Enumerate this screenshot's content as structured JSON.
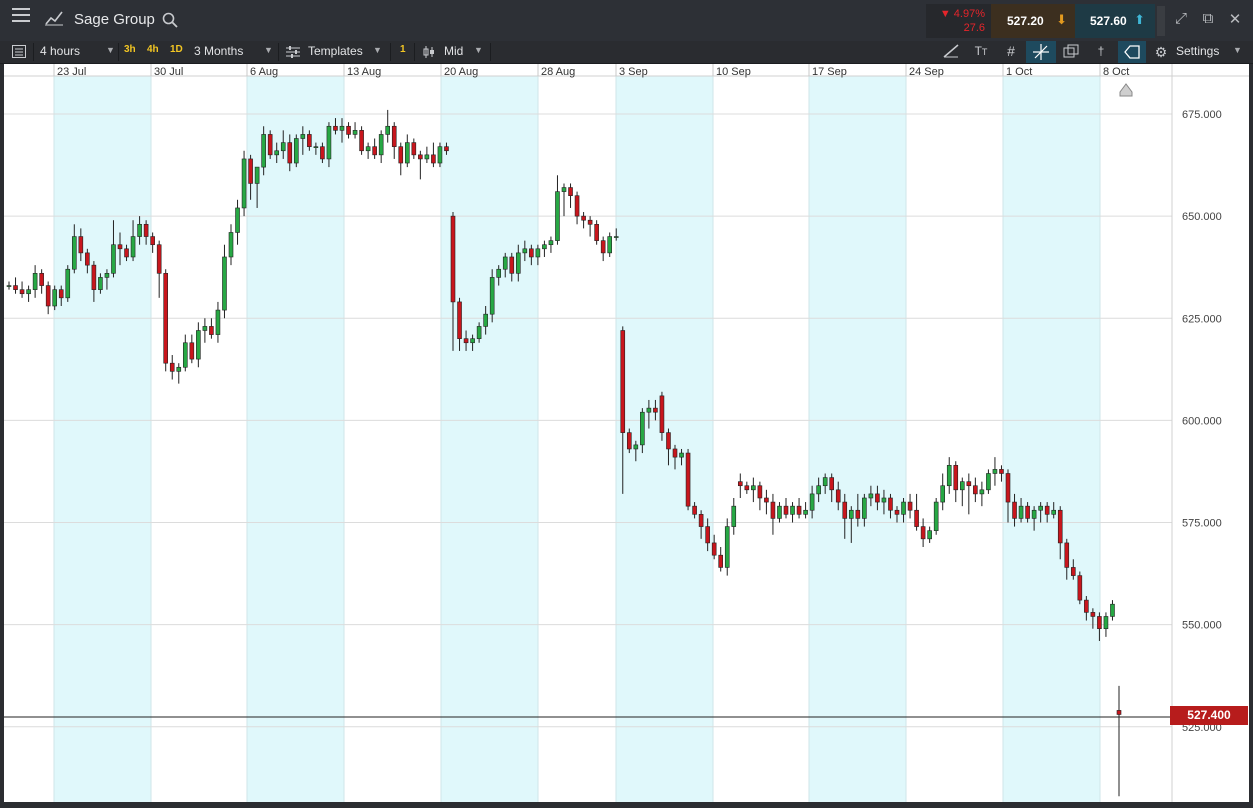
{
  "header": {
    "title": "Sage Group",
    "change_pct": "▼ 4.97%",
    "change_abs": "27.6",
    "sell_price": "527.20",
    "buy_price": "527.60"
  },
  "toolbar": {
    "interval": "4 hours",
    "quick_3h": "3h",
    "quick_4h": "4h",
    "quick_1d": "1D",
    "range": "3 Months",
    "templates": "Templates",
    "count": "1",
    "price_type": "Mid",
    "settings": "Settings"
  },
  "icons": [
    "menu-icon",
    "line-chart-icon",
    "search-icon",
    "arrow-down-icon",
    "arrow-up-icon",
    "expand-icon",
    "popout-icon",
    "close-icon",
    "list-icon",
    "templates-icon",
    "candles-icon",
    "draw-icon",
    "text-icon",
    "grid-icon",
    "crosshair-icon",
    "layers-icon",
    "marker-icon",
    "tag-icon",
    "gear-icon"
  ],
  "colors": {
    "up": "#27a844",
    "down": "#c8161d",
    "shade": "#e0f8fb",
    "current": "#b71c1c",
    "accent": "#1e4a5e"
  },
  "chart_data": {
    "type": "candlestick",
    "title": "",
    "xlabel": "",
    "ylabel": "",
    "x_tick_labels": [
      "23 Jul",
      "30 Jul",
      "6 Aug",
      "13 Aug",
      "20 Aug",
      "28 Aug",
      "3 Sep",
      "10 Sep",
      "17 Sep",
      "24 Sep",
      "1 Oct",
      "8 Oct"
    ],
    "y_tick_labels": [
      "675.000",
      "650.000",
      "625.000",
      "600.000",
      "575.000",
      "550.000",
      "525.000"
    ],
    "y_ticks": [
      675,
      650,
      625,
      600,
      575,
      550,
      525
    ],
    "ylim": [
      507,
      682
    ],
    "current_price": 527.4,
    "current_price_label": "527.400",
    "grid": true,
    "candle_period": "4 hours",
    "ohlc": [
      [
        633,
        634,
        632,
        633
      ],
      [
        633,
        635,
        631,
        632
      ],
      [
        632,
        634,
        630,
        631
      ],
      [
        631,
        633,
        629,
        632
      ],
      [
        632,
        638,
        630,
        636
      ],
      [
        636,
        637,
        631,
        633
      ],
      [
        633,
        634,
        626,
        628
      ],
      [
        628,
        633,
        627,
        632
      ],
      [
        632,
        633,
        628,
        630
      ],
      [
        630,
        638,
        629,
        637
      ],
      [
        637,
        648,
        636,
        645
      ],
      [
        645,
        647,
        639,
        641
      ],
      [
        641,
        642,
        636,
        638
      ],
      [
        638,
        639,
        629,
        632
      ],
      [
        632,
        636,
        631,
        635
      ],
      [
        635,
        637,
        632,
        636
      ],
      [
        636,
        649,
        635,
        643
      ],
      [
        643,
        646,
        638,
        642
      ],
      [
        642,
        643,
        639,
        640
      ],
      [
        640,
        649,
        639,
        645
      ],
      [
        645,
        650,
        643,
        648
      ],
      [
        648,
        649,
        643,
        645
      ],
      [
        645,
        646,
        641,
        643
      ],
      [
        643,
        644,
        630,
        636
      ],
      [
        636,
        637,
        612,
        614
      ],
      [
        614,
        616,
        610,
        612
      ],
      [
        612,
        614,
        609,
        613
      ],
      [
        613,
        621,
        612,
        619
      ],
      [
        619,
        621,
        614,
        615
      ],
      [
        615,
        624,
        613,
        622
      ],
      [
        622,
        625,
        619,
        623
      ],
      [
        623,
        625,
        620,
        621
      ],
      [
        621,
        629,
        619,
        627
      ],
      [
        627,
        643,
        625,
        640
      ],
      [
        640,
        648,
        638,
        646
      ],
      [
        646,
        654,
        643,
        652
      ],
      [
        652,
        666,
        650,
        664
      ],
      [
        664,
        665,
        654,
        658
      ],
      [
        658,
        662,
        652,
        662
      ],
      [
        662,
        672,
        660,
        670
      ],
      [
        670,
        671,
        664,
        665
      ],
      [
        665,
        668,
        663,
        666
      ],
      [
        666,
        671,
        664,
        668
      ],
      [
        668,
        670,
        661,
        663
      ],
      [
        663,
        670,
        662,
        669
      ],
      [
        669,
        672,
        665,
        670
      ],
      [
        670,
        671,
        666,
        667
      ],
      [
        667,
        668,
        665,
        667
      ],
      [
        667,
        668,
        663,
        664
      ],
      [
        664,
        673,
        662,
        672
      ],
      [
        672,
        674,
        670,
        671
      ],
      [
        671,
        674,
        668,
        672
      ],
      [
        672,
        673,
        669,
        670
      ],
      [
        670,
        673,
        669,
        671
      ],
      [
        671,
        672,
        665,
        666
      ],
      [
        666,
        668,
        664,
        667
      ],
      [
        667,
        669,
        664,
        665
      ],
      [
        665,
        671,
        663,
        670
      ],
      [
        670,
        676,
        668,
        672
      ],
      [
        672,
        673,
        664,
        667
      ],
      [
        667,
        668,
        660,
        663
      ],
      [
        663,
        670,
        662,
        668
      ],
      [
        668,
        669,
        664,
        665
      ],
      [
        665,
        666,
        659,
        664
      ],
      [
        664,
        667,
        663,
        665
      ],
      [
        665,
        668,
        662,
        663
      ],
      [
        663,
        668,
        662,
        667
      ],
      [
        667,
        668,
        665,
        666
      ],
      [
        650,
        651,
        617,
        629
      ],
      [
        629,
        630,
        617,
        620
      ],
      [
        620,
        622,
        617,
        619
      ],
      [
        619,
        621,
        617,
        620
      ],
      [
        620,
        624,
        619,
        623
      ],
      [
        623,
        628,
        621,
        626
      ],
      [
        626,
        637,
        624,
        635
      ],
      [
        635,
        638,
        633,
        637
      ],
      [
        637,
        641,
        635,
        640
      ],
      [
        640,
        641,
        634,
        636
      ],
      [
        636,
        643,
        634,
        641
      ],
      [
        641,
        644,
        639,
        642
      ],
      [
        642,
        643,
        638,
        640
      ],
      [
        640,
        643,
        638,
        642
      ],
      [
        642,
        644,
        640,
        643
      ],
      [
        643,
        645,
        641,
        644
      ],
      [
        644,
        660,
        643,
        656
      ],
      [
        656,
        658,
        650,
        657
      ],
      [
        657,
        658,
        652,
        655
      ],
      [
        655,
        656,
        648,
        650
      ],
      [
        650,
        651,
        647,
        649
      ],
      [
        649,
        650,
        645,
        648
      ],
      [
        648,
        649,
        643,
        644
      ],
      [
        644,
        645,
        639,
        641
      ],
      [
        641,
        646,
        640,
        645
      ],
      [
        645,
        647,
        644,
        645
      ],
      [
        622,
        623,
        582,
        597
      ],
      [
        597,
        598,
        592,
        593
      ],
      [
        593,
        595,
        590,
        594
      ],
      [
        594,
        603,
        592,
        602
      ],
      [
        602,
        605,
        598,
        603
      ],
      [
        603,
        605,
        600,
        602
      ],
      [
        606,
        607,
        595,
        597
      ],
      [
        597,
        598,
        589,
        593
      ],
      [
        593,
        594,
        588,
        591
      ],
      [
        591,
        593,
        589,
        592
      ],
      [
        592,
        593,
        578,
        579
      ],
      [
        579,
        580,
        576,
        577
      ],
      [
        577,
        578,
        571,
        574
      ],
      [
        574,
        576,
        568,
        570
      ],
      [
        570,
        572,
        566,
        567
      ],
      [
        567,
        569,
        563,
        564
      ],
      [
        564,
        576,
        562,
        574
      ],
      [
        574,
        581,
        572,
        579
      ],
      [
        585,
        587,
        581,
        584
      ],
      [
        584,
        585,
        582,
        583
      ],
      [
        583,
        586,
        580,
        584
      ],
      [
        584,
        585,
        578,
        581
      ],
      [
        581,
        583,
        577,
        580
      ],
      [
        580,
        582,
        572,
        576
      ],
      [
        576,
        580,
        575,
        579
      ],
      [
        579,
        581,
        576,
        577
      ],
      [
        577,
        580,
        575,
        579
      ],
      [
        579,
        581,
        576,
        577
      ],
      [
        577,
        580,
        576,
        578
      ],
      [
        578,
        584,
        576,
        582
      ],
      [
        582,
        586,
        580,
        584
      ],
      [
        584,
        587,
        582,
        586
      ],
      [
        586,
        587,
        580,
        583
      ],
      [
        583,
        585,
        578,
        580
      ],
      [
        580,
        582,
        571,
        576
      ],
      [
        576,
        579,
        570,
        578
      ],
      [
        578,
        582,
        574,
        576
      ],
      [
        576,
        582,
        574,
        581
      ],
      [
        581,
        584,
        579,
        582
      ],
      [
        582,
        584,
        578,
        580
      ],
      [
        580,
        583,
        577,
        581
      ],
      [
        581,
        582,
        576,
        578
      ],
      [
        578,
        579,
        575,
        577
      ],
      [
        577,
        581,
        575,
        580
      ],
      [
        580,
        582,
        576,
        578
      ],
      [
        578,
        582,
        573,
        574
      ],
      [
        574,
        576,
        569,
        571
      ],
      [
        571,
        574,
        570,
        573
      ],
      [
        573,
        581,
        572,
        580
      ],
      [
        580,
        587,
        578,
        584
      ],
      [
        584,
        591,
        582,
        589
      ],
      [
        589,
        590,
        580,
        583
      ],
      [
        583,
        586,
        579,
        585
      ],
      [
        585,
        587,
        577,
        584
      ],
      [
        584,
        586,
        580,
        582
      ],
      [
        582,
        585,
        579,
        583
      ],
      [
        583,
        588,
        582,
        587
      ],
      [
        587,
        591,
        584,
        588
      ],
      [
        588,
        589,
        585,
        587
      ],
      [
        587,
        588,
        575,
        580
      ],
      [
        580,
        582,
        574,
        576
      ],
      [
        576,
        581,
        575,
        579
      ],
      [
        579,
        580,
        575,
        576
      ],
      [
        576,
        579,
        573,
        578
      ],
      [
        578,
        580,
        575,
        579
      ],
      [
        579,
        580,
        575,
        577
      ],
      [
        577,
        580,
        576,
        578
      ],
      [
        578,
        579,
        566,
        570
      ],
      [
        570,
        571,
        561,
        564
      ],
      [
        564,
        566,
        561,
        562
      ],
      [
        562,
        563,
        555,
        556
      ],
      [
        556,
        557,
        551,
        553
      ],
      [
        553,
        554,
        549,
        552
      ],
      [
        552,
        553,
        546,
        549
      ],
      [
        549,
        553,
        547,
        552
      ],
      [
        552,
        556,
        551,
        555
      ],
      [
        529,
        535,
        508,
        528
      ]
    ]
  }
}
